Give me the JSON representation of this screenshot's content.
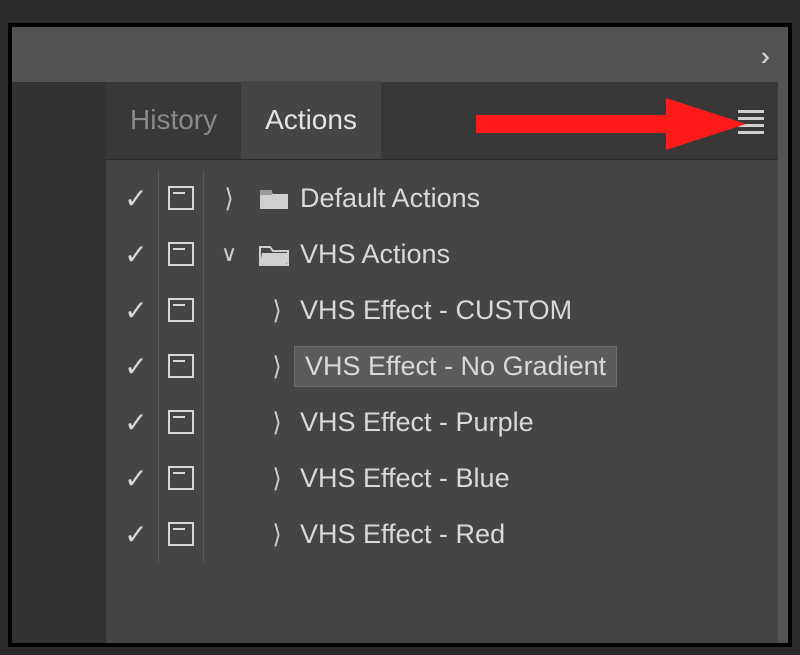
{
  "tabs": {
    "history": "History",
    "actions": "Actions",
    "active": "actions"
  },
  "rows": [
    {
      "check": true,
      "dialog": true,
      "caret": "right",
      "nested": false,
      "folder": "closed",
      "label": "Default Actions",
      "selected": false
    },
    {
      "check": true,
      "dialog": true,
      "caret": "down",
      "nested": false,
      "folder": "open",
      "label": "VHS Actions",
      "selected": false
    },
    {
      "check": true,
      "dialog": true,
      "caret": "right",
      "nested": true,
      "folder": null,
      "label": "VHS Effect - CUSTOM",
      "selected": false
    },
    {
      "check": true,
      "dialog": true,
      "caret": "right",
      "nested": true,
      "folder": null,
      "label": "VHS Effect - No Gradient",
      "selected": true
    },
    {
      "check": true,
      "dialog": true,
      "caret": "right",
      "nested": true,
      "folder": null,
      "label": "VHS Effect - Purple",
      "selected": false
    },
    {
      "check": true,
      "dialog": true,
      "caret": "right",
      "nested": true,
      "folder": null,
      "label": "VHS Effect - Blue",
      "selected": false
    },
    {
      "check": true,
      "dialog": true,
      "caret": "right",
      "nested": true,
      "folder": null,
      "label": "VHS Effect - Red",
      "selected": false
    }
  ],
  "annotation": {
    "color": "#ff1a1a"
  }
}
